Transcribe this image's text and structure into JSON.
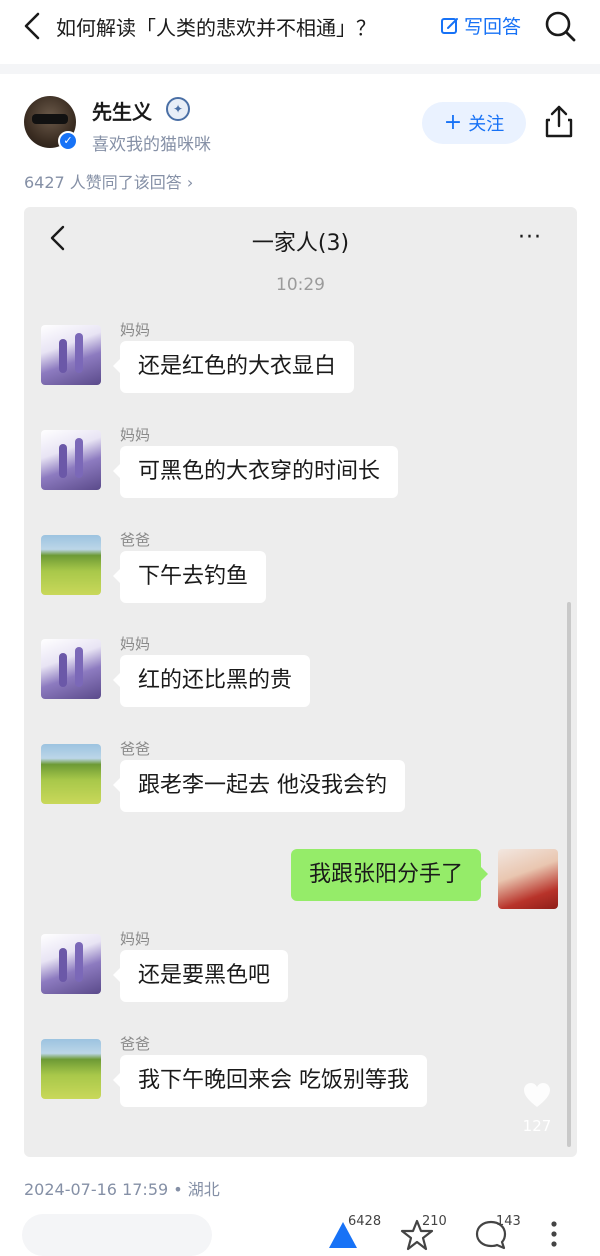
{
  "header": {
    "question_title": "如何解读「人类的悲欢并不相通」？",
    "write_answer_label": "写回答"
  },
  "author": {
    "name": "先生义",
    "bio": "喜欢我的猫咪咪",
    "follow_label": "关注"
  },
  "answer": {
    "likes_summary": "6427 人赞同了该回答"
  },
  "chat_screenshot": {
    "group_title": "一家人(3)",
    "more_label": "···",
    "time": "10:29",
    "messages": [
      {
        "sender": "妈妈",
        "text": "还是红色的大衣显白",
        "avatar": "lavender"
      },
      {
        "sender": "妈妈",
        "text": "可黑色的大衣穿的时间长",
        "avatar": "lavender"
      },
      {
        "sender": "爸爸",
        "text": "下午去钓鱼",
        "avatar": "meadow"
      },
      {
        "sender": "妈妈",
        "text": "红的还比黑的贵",
        "avatar": "lavender"
      },
      {
        "sender": "爸爸",
        "text": "跟老李一起去 他没我会钓",
        "avatar": "meadow"
      },
      {
        "sender": "",
        "text": "我跟张阳分手了",
        "avatar": "princess",
        "self": true
      },
      {
        "sender": "妈妈",
        "text": "还是要黑色吧",
        "avatar": "lavender"
      },
      {
        "sender": "爸爸",
        "text": "我下午晚回来会 吃饭别等我",
        "avatar": "meadow"
      }
    ],
    "float_like_count": "127"
  },
  "footer": {
    "meta": "2024-07-16 17:59 • 湖北",
    "comment_placeholder": "",
    "upvote_count": "6428",
    "favorite_count": "210",
    "comment_count": "143"
  },
  "colors": {
    "brand_blue": "#1772f6",
    "wechat_green": "#95ec69",
    "chat_bg": "#ededed"
  }
}
